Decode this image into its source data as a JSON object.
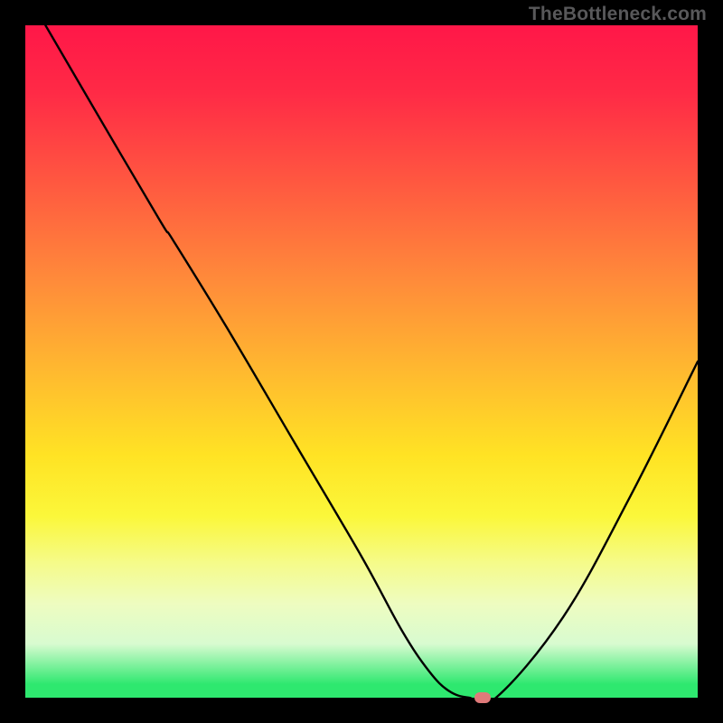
{
  "watermark": "TheBottleneck.com",
  "chart_data": {
    "type": "line",
    "title": "",
    "xlabel": "",
    "ylabel": "",
    "xlim": [
      0,
      100
    ],
    "ylim": [
      0,
      100
    ],
    "grid": false,
    "series": [
      {
        "name": "curve",
        "x": [
          3,
          10,
          20,
          22,
          30,
          40,
          50,
          56,
          60,
          63,
          66,
          70,
          80,
          90,
          100
        ],
        "y": [
          100,
          88,
          71,
          68,
          55,
          38,
          21,
          10,
          4,
          1,
          0,
          0,
          12,
          30,
          50
        ]
      }
    ],
    "marker": {
      "x": 68,
      "y": 0
    },
    "background_gradient": {
      "top": "#ff1748",
      "mid": "#ffe324",
      "bottom": "#2ee86f"
    }
  }
}
